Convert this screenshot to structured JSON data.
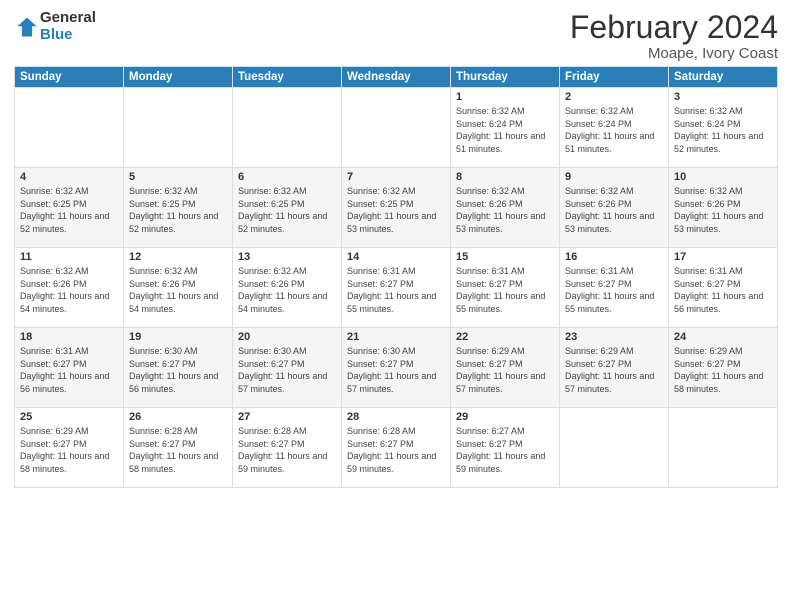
{
  "logo": {
    "general": "General",
    "blue": "Blue"
  },
  "title": "February 2024",
  "subtitle": "Moape, Ivory Coast",
  "days_of_week": [
    "Sunday",
    "Monday",
    "Tuesday",
    "Wednesday",
    "Thursday",
    "Friday",
    "Saturday"
  ],
  "weeks": [
    [
      {
        "day": "",
        "info": ""
      },
      {
        "day": "",
        "info": ""
      },
      {
        "day": "",
        "info": ""
      },
      {
        "day": "",
        "info": ""
      },
      {
        "day": "1",
        "info": "Sunrise: 6:32 AM\nSunset: 6:24 PM\nDaylight: 11 hours and 51 minutes."
      },
      {
        "day": "2",
        "info": "Sunrise: 6:32 AM\nSunset: 6:24 PM\nDaylight: 11 hours and 51 minutes."
      },
      {
        "day": "3",
        "info": "Sunrise: 6:32 AM\nSunset: 6:24 PM\nDaylight: 11 hours and 52 minutes."
      }
    ],
    [
      {
        "day": "4",
        "info": "Sunrise: 6:32 AM\nSunset: 6:25 PM\nDaylight: 11 hours and 52 minutes."
      },
      {
        "day": "5",
        "info": "Sunrise: 6:32 AM\nSunset: 6:25 PM\nDaylight: 11 hours and 52 minutes."
      },
      {
        "day": "6",
        "info": "Sunrise: 6:32 AM\nSunset: 6:25 PM\nDaylight: 11 hours and 52 minutes."
      },
      {
        "day": "7",
        "info": "Sunrise: 6:32 AM\nSunset: 6:25 PM\nDaylight: 11 hours and 53 minutes."
      },
      {
        "day": "8",
        "info": "Sunrise: 6:32 AM\nSunset: 6:26 PM\nDaylight: 11 hours and 53 minutes."
      },
      {
        "day": "9",
        "info": "Sunrise: 6:32 AM\nSunset: 6:26 PM\nDaylight: 11 hours and 53 minutes."
      },
      {
        "day": "10",
        "info": "Sunrise: 6:32 AM\nSunset: 6:26 PM\nDaylight: 11 hours and 53 minutes."
      }
    ],
    [
      {
        "day": "11",
        "info": "Sunrise: 6:32 AM\nSunset: 6:26 PM\nDaylight: 11 hours and 54 minutes."
      },
      {
        "day": "12",
        "info": "Sunrise: 6:32 AM\nSunset: 6:26 PM\nDaylight: 11 hours and 54 minutes."
      },
      {
        "day": "13",
        "info": "Sunrise: 6:32 AM\nSunset: 6:26 PM\nDaylight: 11 hours and 54 minutes."
      },
      {
        "day": "14",
        "info": "Sunrise: 6:31 AM\nSunset: 6:27 PM\nDaylight: 11 hours and 55 minutes."
      },
      {
        "day": "15",
        "info": "Sunrise: 6:31 AM\nSunset: 6:27 PM\nDaylight: 11 hours and 55 minutes."
      },
      {
        "day": "16",
        "info": "Sunrise: 6:31 AM\nSunset: 6:27 PM\nDaylight: 11 hours and 55 minutes."
      },
      {
        "day": "17",
        "info": "Sunrise: 6:31 AM\nSunset: 6:27 PM\nDaylight: 11 hours and 56 minutes."
      }
    ],
    [
      {
        "day": "18",
        "info": "Sunrise: 6:31 AM\nSunset: 6:27 PM\nDaylight: 11 hours and 56 minutes."
      },
      {
        "day": "19",
        "info": "Sunrise: 6:30 AM\nSunset: 6:27 PM\nDaylight: 11 hours and 56 minutes."
      },
      {
        "day": "20",
        "info": "Sunrise: 6:30 AM\nSunset: 6:27 PM\nDaylight: 11 hours and 57 minutes."
      },
      {
        "day": "21",
        "info": "Sunrise: 6:30 AM\nSunset: 6:27 PM\nDaylight: 11 hours and 57 minutes."
      },
      {
        "day": "22",
        "info": "Sunrise: 6:29 AM\nSunset: 6:27 PM\nDaylight: 11 hours and 57 minutes."
      },
      {
        "day": "23",
        "info": "Sunrise: 6:29 AM\nSunset: 6:27 PM\nDaylight: 11 hours and 57 minutes."
      },
      {
        "day": "24",
        "info": "Sunrise: 6:29 AM\nSunset: 6:27 PM\nDaylight: 11 hours and 58 minutes."
      }
    ],
    [
      {
        "day": "25",
        "info": "Sunrise: 6:29 AM\nSunset: 6:27 PM\nDaylight: 11 hours and 58 minutes."
      },
      {
        "day": "26",
        "info": "Sunrise: 6:28 AM\nSunset: 6:27 PM\nDaylight: 11 hours and 58 minutes."
      },
      {
        "day": "27",
        "info": "Sunrise: 6:28 AM\nSunset: 6:27 PM\nDaylight: 11 hours and 59 minutes."
      },
      {
        "day": "28",
        "info": "Sunrise: 6:28 AM\nSunset: 6:27 PM\nDaylight: 11 hours and 59 minutes."
      },
      {
        "day": "29",
        "info": "Sunrise: 6:27 AM\nSunset: 6:27 PM\nDaylight: 11 hours and 59 minutes."
      },
      {
        "day": "",
        "info": ""
      },
      {
        "day": "",
        "info": ""
      }
    ]
  ]
}
